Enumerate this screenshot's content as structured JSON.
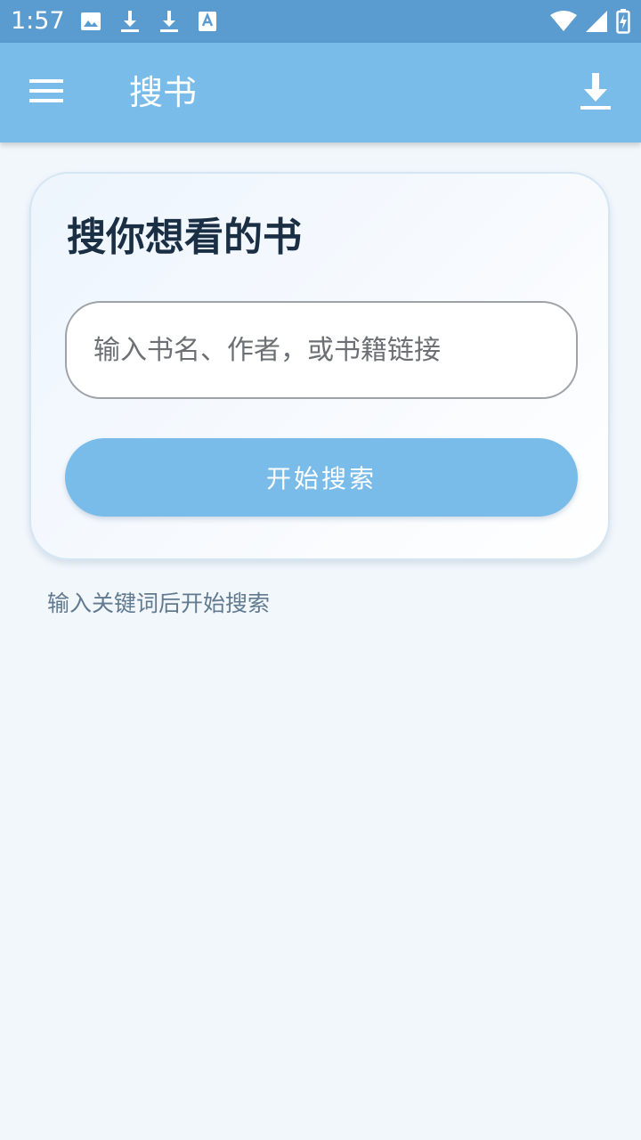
{
  "status_bar": {
    "time": "1:57",
    "left_icons": [
      "image-icon",
      "download-icon",
      "download-icon",
      "text-a-icon"
    ],
    "right_icons": [
      "wifi-icon",
      "cell-signal-icon",
      "battery-charging-icon"
    ]
  },
  "app_bar": {
    "menu_icon": "menu-icon",
    "title": "搜书",
    "download_icon": "download-icon",
    "background": "#79bcea"
  },
  "search_card": {
    "title": "搜你想看的书",
    "input": {
      "value": "",
      "placeholder": "输入书名、作者，或书籍链接"
    },
    "search_button_label": "开始搜索"
  },
  "hint": "输入关键词后开始搜索",
  "colors": {
    "status_bar": "#5a9ccf",
    "accent": "#79bcea",
    "page_background": "#f2f7fc",
    "title_text": "#1a2e44",
    "hint_text": "#617a90"
  }
}
